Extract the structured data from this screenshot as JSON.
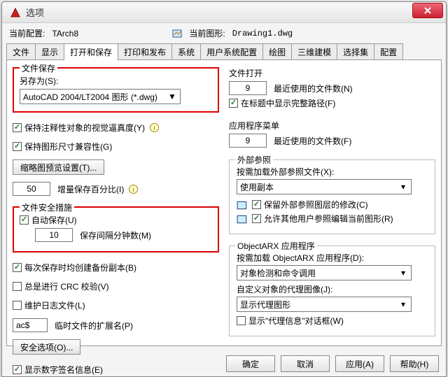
{
  "window": {
    "title": "选项"
  },
  "cfg": {
    "current_cfg_label": "当前配置:",
    "current_cfg_value": "TArch8",
    "current_dwg_label": "当前图形:",
    "current_dwg_value": "Drawing1.dwg"
  },
  "tabs": [
    "文件",
    "显示",
    "打开和保存",
    "打印和发布",
    "系统",
    "用户系统配置",
    "绘图",
    "三维建模",
    "选择集",
    "配置"
  ],
  "active_tab": "打开和保存",
  "left": {
    "file_save": {
      "title": "文件保存",
      "save_as_label": "另存为(S):",
      "save_as_value": "AutoCAD 2004/LT2004 图形 (*.dwg)",
      "chk_annot": "保持注释性对象的视觉逼真度(Y)",
      "chk_compat": "保持图形尺寸兼容性(G)",
      "btn_thumb": "缩略图预览设置(T)...",
      "increment_save_value": "50",
      "increment_save_label": "增量保存百分比(I)"
    },
    "safety": {
      "title": "文件安全措施",
      "chk_autosave": "自动保存(U)",
      "autosave_value": "10",
      "autosave_label": "保存间隔分钟数(M)",
      "chk_backup": "每次保存时均创建备份副本(B)",
      "chk_crc": "总是进行 CRC 校验(V)",
      "chk_log": "维护日志文件(L)",
      "tempext_value": "ac$",
      "tempext_label": "临时文件的扩展名(P)",
      "btn_secopt": "安全选项(O)..."
    },
    "chk_sig": "显示数字签名信息(E)"
  },
  "right": {
    "file_open": {
      "title": "文件打开",
      "recent_count": "9",
      "recent_label": "最近使用的文件数(N)",
      "chk_fullpath": "在标题中显示完整路径(F)"
    },
    "app_menu": {
      "title": "应用程序菜单",
      "recent_count": "9",
      "recent_label": "最近使用的文件数(F)"
    },
    "xref": {
      "title": "外部参照",
      "load_label": "按需加载外部参照文件(X):",
      "load_value": "使用副本",
      "chk_retain": "保留外部参照图层的修改(C)",
      "chk_allow": "允许其他用户参照编辑当前图形(R)"
    },
    "objectarx": {
      "title": "ObjectARX 应用程序",
      "load_label": "按需加载 ObjectARX 应用程序(D):",
      "load_value": "对象检测和命令调用",
      "proxy_label": "自定义对象的代理图像(J):",
      "proxy_value": "显示代理图形",
      "chk_proxydlg": "显示\"代理信息\"对话框(W)"
    }
  },
  "buttons": {
    "ok": "确定",
    "cancel": "取消",
    "apply": "应用(A)",
    "help": "帮助(H)"
  }
}
